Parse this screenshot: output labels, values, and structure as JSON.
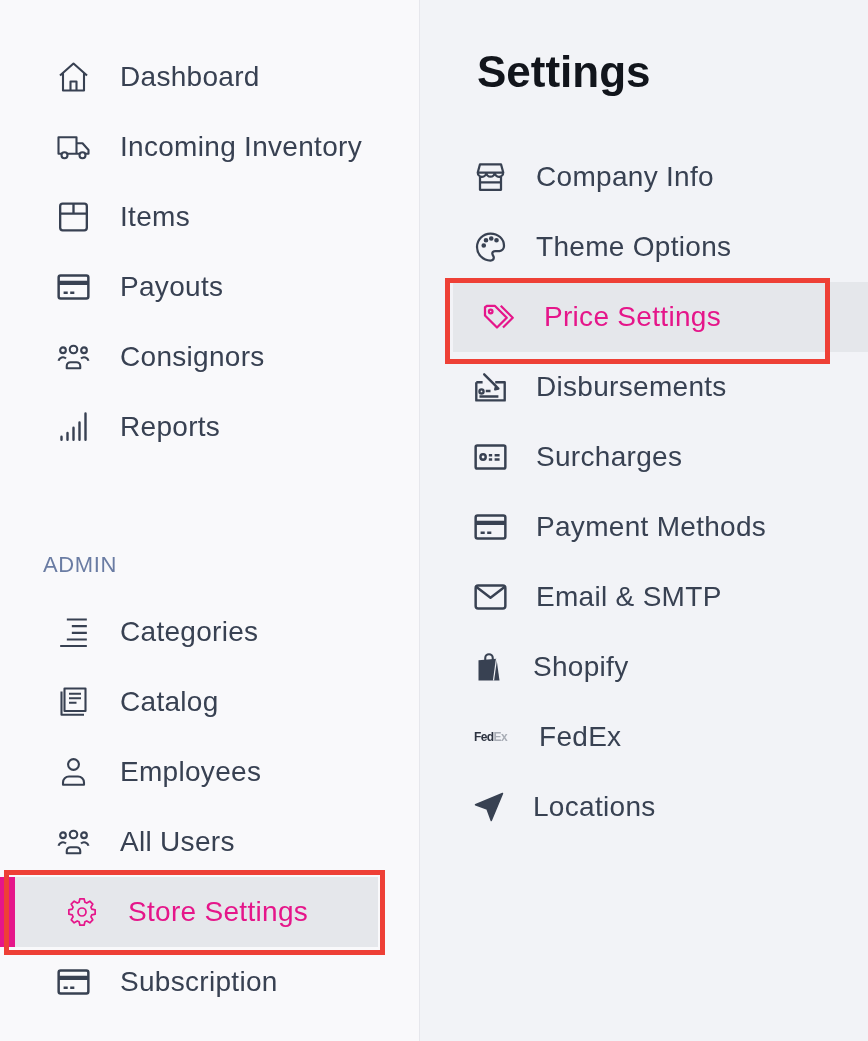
{
  "sidebar": {
    "items": [
      {
        "label": "Dashboard",
        "selected": false,
        "annotated": false
      },
      {
        "label": "Incoming Inventory",
        "selected": false,
        "annotated": false
      },
      {
        "label": "Items",
        "selected": false,
        "annotated": false
      },
      {
        "label": "Payouts",
        "selected": false,
        "annotated": false
      },
      {
        "label": "Consignors",
        "selected": false,
        "annotated": false
      },
      {
        "label": "Reports",
        "selected": false,
        "annotated": false
      }
    ],
    "sections": [
      {
        "title": "ADMIN",
        "items": [
          {
            "label": "Categories",
            "selected": false,
            "annotated": false
          },
          {
            "label": "Catalog",
            "selected": false,
            "annotated": false
          },
          {
            "label": "Employees",
            "selected": false,
            "annotated": false
          },
          {
            "label": "All Users",
            "selected": false,
            "annotated": false
          },
          {
            "label": "Store Settings",
            "selected": true,
            "annotated": true
          },
          {
            "label": "Subscription",
            "selected": false,
            "annotated": false
          }
        ]
      }
    ]
  },
  "settings": {
    "title": "Settings",
    "items": [
      {
        "label": "Company Info",
        "kind": "icon",
        "selected": false,
        "annotated": false
      },
      {
        "label": "Theme Options",
        "kind": "icon",
        "selected": false,
        "annotated": false
      },
      {
        "label": "Price Settings",
        "kind": "icon",
        "selected": true,
        "annotated": true
      },
      {
        "label": "Disbursements",
        "kind": "icon",
        "selected": false,
        "annotated": false
      },
      {
        "label": "Surcharges",
        "kind": "icon",
        "selected": false,
        "annotated": false
      },
      {
        "label": "Payment Methods",
        "kind": "icon",
        "selected": false,
        "annotated": false
      },
      {
        "label": "Email & SMTP",
        "kind": "icon",
        "selected": false,
        "annotated": false
      },
      {
        "label": "Shopify",
        "kind": "icon",
        "selected": false,
        "annotated": false
      },
      {
        "label": "FedEx",
        "kind": "wordmark",
        "logo_text": "**Fed**Ex",
        "selected": false,
        "annotated": false
      },
      {
        "label": "Locations",
        "kind": "icon",
        "selected": false,
        "annotated": false
      }
    ]
  }
}
